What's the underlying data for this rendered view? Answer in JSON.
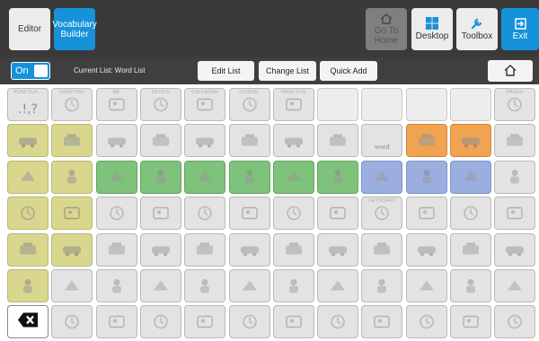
{
  "toolbar": {
    "editor": "Editor",
    "vocab_builder": "Vocabulary Builder",
    "go_to_home": "Go To Home",
    "desktop": "Desktop",
    "toolbox": "Toolbox",
    "exit": "Exit"
  },
  "subbar": {
    "toggle_label": "On",
    "current_list": "Current List: Word List",
    "edit_list": "Edit List",
    "change_list": "Change List",
    "quick_add": "Quick Add"
  },
  "grid": {
    "cell_labels": {
      "r0c0": "PUNCTUA...",
      "r0c1": "GREETING",
      "r0c2": "ME",
      "r0c3": "DEVICE",
      "r0c4": "CALENDAR",
      "r0c5": "SCHOOL",
      "r0c6": "HAVE FUN",
      "r0c11": "PAGES",
      "r3c8": "KEYBOARD"
    },
    "punct_symbol": ".!,?",
    "word_cell_text": "word"
  },
  "colors": {
    "toolbar_bg": "#3a3a3a",
    "accent_blue": "#1592d9",
    "core_yellow": "#d9d68e",
    "core_green": "#7ec27b",
    "core_orange": "#f0a351",
    "core_blue": "#9aaee0",
    "cell_gray": "#e3e3e3"
  },
  "icons": {
    "go_to_home": "home-icon",
    "desktop": "windows-icon",
    "toolbox": "wrench-icon",
    "exit": "exit-icon",
    "home": "house-outline-icon",
    "delete": "backspace-icon"
  }
}
